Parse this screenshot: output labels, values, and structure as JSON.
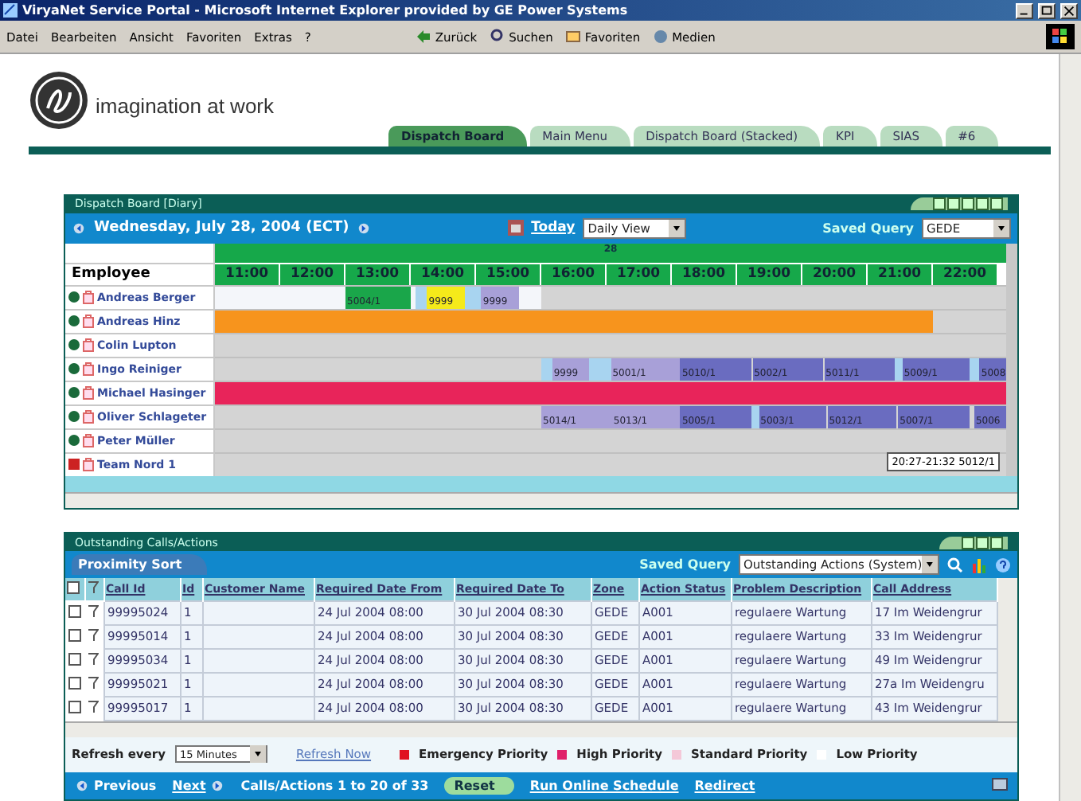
{
  "window": {
    "title": "ViryaNet Service Portal - Microsoft Internet Explorer provided by GE Power Systems"
  },
  "menu": [
    "Datei",
    "Bearbeiten",
    "Ansicht",
    "Favoriten",
    "Extras",
    "?"
  ],
  "toolbar": [
    {
      "kind": "back",
      "label": "Zurück"
    },
    {
      "kind": "search",
      "label": "Suchen"
    },
    {
      "kind": "favorites",
      "label": "Favoriten"
    },
    {
      "kind": "media",
      "label": "Medien"
    }
  ],
  "header": {
    "tagline": "imagination at work",
    "tabs": [
      {
        "label": "Dispatch Board",
        "selected": true
      },
      {
        "label": "Main Menu",
        "selected": false
      },
      {
        "label": "Dispatch Board (Stacked)",
        "selected": false
      },
      {
        "label": "KPI",
        "selected": false
      },
      {
        "label": "SIAS",
        "selected": false
      },
      {
        "label": "#6",
        "selected": false
      }
    ]
  },
  "dispatch": {
    "title": "Dispatch Board [Diary]",
    "date": "Wednesday, July 28, 2004 (ECT)",
    "today": "Today",
    "view": "Daily View",
    "saved_query_label": "Saved Query",
    "saved_query": "GEDE",
    "day": "28",
    "employee_heading": "Employee",
    "hours": [
      "11:00",
      "12:00",
      "13:00",
      "14:00",
      "15:00",
      "16:00",
      "17:00",
      "18:00",
      "19:00",
      "20:00",
      "21:00",
      "22:00"
    ],
    "employees": [
      {
        "name": "Andreas Berger",
        "kind": "available",
        "blocks": [
          {
            "color": "#f4f6fa"
          },
          {
            "color": "#1aa64a",
            "label": "5004/1"
          },
          {
            "color": "#a8d4f0"
          },
          {
            "color": "#f5ea1a",
            "label": "9999"
          },
          {
            "color": "#a8d4f0"
          },
          {
            "color": "#a8a0d8",
            "label": "9999"
          }
        ]
      },
      {
        "name": "Andreas Hinz",
        "kind": "available",
        "blocks": [
          {
            "color": "#f7941d"
          }
        ]
      },
      {
        "name": "Colin Lupton",
        "kind": "available"
      },
      {
        "name": "Ingo Reiniger",
        "kind": "available",
        "blocks": [
          {
            "color": "#a8d4f0"
          },
          {
            "color": "#a8a0d8",
            "label": "9999"
          },
          {
            "color": "#a8d4f0"
          },
          {
            "color": "#a8a0d8",
            "label": "5001/1"
          },
          {
            "color": "#6a6cc0",
            "label": "5010/1"
          },
          {
            "color": "#6a6cc0",
            "label": "5002/1"
          },
          {
            "color": "#6a6cc0",
            "label": "5011/1"
          },
          {
            "color": "#a8d4f0"
          },
          {
            "color": "#6a6cc0",
            "label": "5009/1"
          },
          {
            "color": "#a8d4f0"
          },
          {
            "color": "#6a6cc0",
            "label": "5008"
          }
        ]
      },
      {
        "name": "Michael Hasinger",
        "kind": "available",
        "blocks": [
          {
            "color": "#e8245a"
          }
        ]
      },
      {
        "name": "Oliver Schlageter",
        "kind": "available",
        "blocks": [
          {
            "color": "#a8a0d8",
            "label": "5014/1"
          },
          {
            "color": "#a8a0d8",
            "label": "5013/1"
          },
          {
            "color": "#6a6cc0",
            "label": "5005/1"
          },
          {
            "color": "#a8d4f0"
          },
          {
            "color": "#6a6cc0",
            "label": "5003/1"
          },
          {
            "color": "#6a6cc0",
            "label": "5012/1"
          },
          {
            "color": "#6a6cc0",
            "label": "5007/1"
          },
          {
            "color": "#6a6cc0",
            "label": "5006"
          }
        ]
      },
      {
        "name": "Peter Müller",
        "kind": "available"
      },
      {
        "name": "Team Nord 1",
        "kind": "unavailable"
      }
    ],
    "tooltip": "20:27-21:32 5012/1"
  },
  "outstanding": {
    "title": "Outstanding Calls/Actions",
    "sort_button": "Proximity Sort",
    "saved_query_label": "Saved Query",
    "saved_query": "Outstanding Actions (System)",
    "select_all_checked": false,
    "columns": [
      "Call Id",
      "Id",
      "Customer Name",
      "Required Date From",
      "Required Date To",
      "Zone",
      "Action Status",
      "Problem Description",
      "Call Address"
    ],
    "rows": [
      {
        "checked": false,
        "cells": [
          "99995024",
          "1",
          "",
          "24 Jul 2004 08:00",
          "30 Jul 2004 08:30",
          "GEDE",
          "A001",
          "regulaere Wartung",
          "17 Im Weidengrur"
        ]
      },
      {
        "checked": false,
        "cells": [
          "99995014",
          "1",
          "",
          "24 Jul 2004 08:00",
          "30 Jul 2004 08:30",
          "GEDE",
          "A001",
          "regulaere Wartung",
          "33 Im Weidengrur"
        ]
      },
      {
        "checked": false,
        "cells": [
          "99995034",
          "1",
          "",
          "24 Jul 2004 08:00",
          "30 Jul 2004 08:30",
          "GEDE",
          "A001",
          "regulaere Wartung",
          "49 Im Weidengrur"
        ]
      },
      {
        "checked": false,
        "cells": [
          "99995021",
          "1",
          "",
          "24 Jul 2004 08:00",
          "30 Jul 2004 08:30",
          "GEDE",
          "A001",
          "regulaere Wartung",
          "27a Im Weidengru"
        ]
      },
      {
        "checked": false,
        "cells": [
          "99995017",
          "1",
          "",
          "24 Jul 2004 08:00",
          "30 Jul 2004 08:30",
          "GEDE",
          "A001",
          "regulaere Wartung",
          "43 Im Weidengrur"
        ]
      }
    ],
    "refresh_label": "Refresh every",
    "refresh_interval": "15 Minutes",
    "refresh_now": "Refresh Now",
    "legend": [
      {
        "label": "Emergency Priority",
        "color": "#e01020"
      },
      {
        "label": "High Priority",
        "color": "#e0206a"
      },
      {
        "label": "Standard Priority",
        "color": "#f4c8d8"
      },
      {
        "label": "Low Priority",
        "color": "#ffffff"
      }
    ],
    "previous": "Previous",
    "next": "Next",
    "count": "Calls/Actions 1 to 20 of 33",
    "reset": "Reset",
    "run_schedule": "Run Online Schedule",
    "redirect": "Redirect"
  }
}
